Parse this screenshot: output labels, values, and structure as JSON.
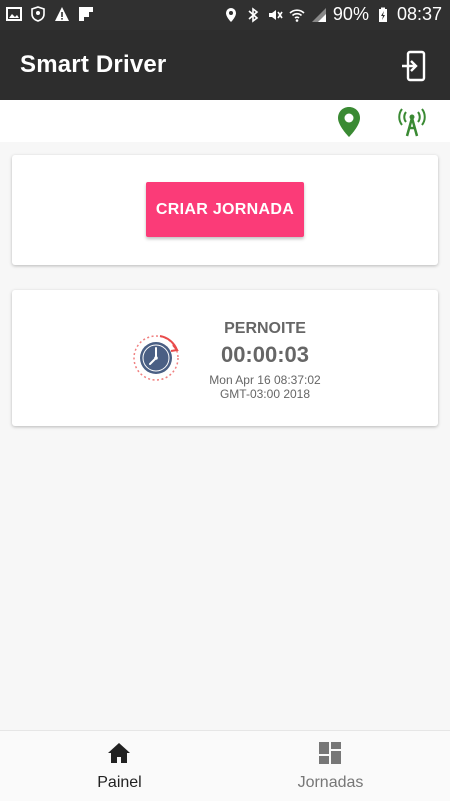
{
  "status_bar": {
    "battery": "90%",
    "time": "08:37"
  },
  "app_bar": {
    "title": "Smart Driver"
  },
  "actions": {
    "criar_label": "CRIAR JORNADA"
  },
  "jornada": {
    "title": "PERNOITE",
    "timer": "00:00:03",
    "date_line1": "Mon Apr 16 08:37:02",
    "date_line2": "GMT-03:00 2018"
  },
  "bottom_nav": {
    "items": [
      {
        "label": "Painel",
        "icon": "home-icon",
        "active": true
      },
      {
        "label": "Jornadas",
        "icon": "dashboard-icon",
        "active": false
      }
    ]
  },
  "colors": {
    "accent": "#fb3b78",
    "status_green": "#3a8a33",
    "app_bar": "#2d2d2d"
  }
}
